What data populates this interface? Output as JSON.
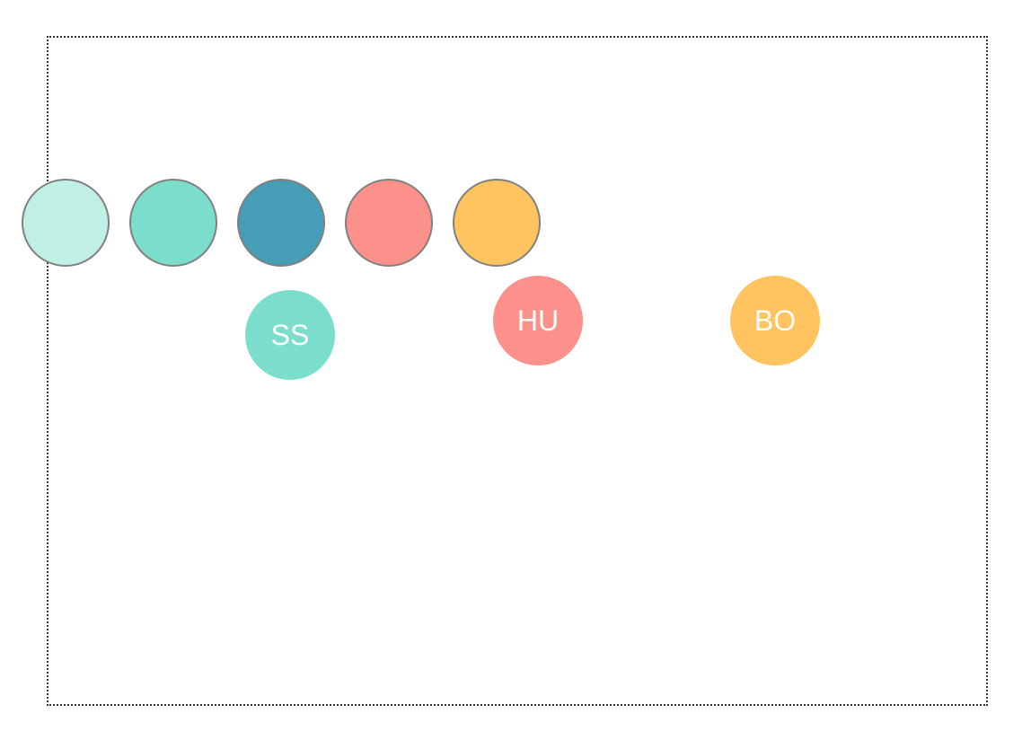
{
  "palette": {
    "swatches": [
      {
        "name": "swatch-pale-mint",
        "color": "#c0efe6"
      },
      {
        "name": "swatch-turquoise",
        "color": "#7bdecc"
      },
      {
        "name": "swatch-teal-blue",
        "color": "#459db8"
      },
      {
        "name": "swatch-salmon",
        "color": "#fb918a"
      },
      {
        "name": "swatch-amber",
        "color": "#ffc35f"
      }
    ]
  },
  "tokens": [
    {
      "label": "SS",
      "color": "#7bdecc"
    },
    {
      "label": "HU",
      "color": "#fb918a"
    },
    {
      "label": "BO",
      "color": "#ffc35f"
    }
  ]
}
